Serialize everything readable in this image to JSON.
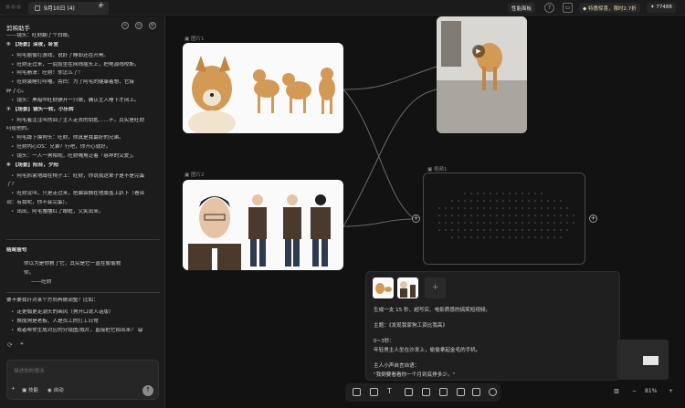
{
  "window": {
    "tab_title": "9月10日 (4)",
    "tab_close": "✕",
    "tab_add": "+"
  },
  "topbar": {
    "perf_label": "性能面板",
    "promo_label": "特惠惊喜，限时2.7折",
    "credits": "77488"
  },
  "sidebar": {
    "title": "剪映助手",
    "lines": [
      {
        "text": "——镜头：旺财翻了个白眼。",
        "style": "normal"
      },
      {
        "text": "⑤ 【场景】深夜，卧室",
        "style": "h"
      },
      {
        "text": "阿毛偷偷打游戏，说好了睡却还在开黑。",
        "style": "bullet"
      },
      {
        "text": "旺财走过来，一屁股坐在网线插头上，把电源线咬断。",
        "style": "bullet"
      },
      {
        "text": "阿毛崩溃：旺财！你怎么了！",
        "style": "bullet"
      },
      {
        "text": "旺财装睡打呼噜。旁白：为了阿毛的健康着想，它接",
        "style": "bullet"
      },
      {
        "text": "  碎了心。",
        "style": "normal"
      },
      {
        "text": "镜头：黑暗中旺财静开一只眼，确认主人睡下才闭上。",
        "style": "bullet"
      },
      {
        "text": "⑦ 【场景】镜头一转，小乐转",
        "style": "h"
      },
      {
        "text": "阿毛着注注叫然回了主人走去的钥匙……不，其实是旺财",
        "style": "bullet"
      },
      {
        "text": "  叼给他的。",
        "style": "normal"
      },
      {
        "text": "阿毛蹲下摸狗头：旺财，你真是我最好的兄弟。",
        "style": "bullet"
      },
      {
        "text": "旺财内心OS：兄弟？行吧，你开心就好。",
        "style": "bullet"
      },
      {
        "text": "镜头：一人一狗相视，旺财嘴角泛着「慈祥的父爱」。",
        "style": "bullet"
      },
      {
        "text": "⑧ 【场景】阳台，夕阳",
        "style": "h"
      },
      {
        "text": "阿毛抓紧地蹲在椅子上：旺财，你说我这辈子是不是完蛋",
        "style": "bullet"
      },
      {
        "text": "  了？",
        "style": "normal"
      },
      {
        "text": "旺财没叫，只是走过来，把脑袋搁在他膝盖上趴下（看台",
        "style": "bullet"
      },
      {
        "text": "  词：有我呢，你不会完蛋）。",
        "style": "normal"
      },
      {
        "text": "出出，阿毛撸撸红了眼眶，又笑出来。",
        "style": "bullet"
      }
    ],
    "ending_title": "结尾金句",
    "ending_quote_1": "你以为是你救了它，其实是它一直在偷偷救",
    "ending_quote_2": "你。",
    "ending_quote_3": "——旺财",
    "followup": "要不要我针对某个方向再做调整？比如：",
    "options": [
      "走更煽更走潮头的画风（狗开口说人话版）",
      "换成狗是老板、人是员工的打工日常",
      "或者帮你生成对应的分镜图/成片，直接把它拍出来？ 😄"
    ],
    "input_placeholder": "描述你的想法",
    "skill_label": "技能",
    "auto_label": "自动",
    "send": "↑"
  },
  "canvas": {
    "card1_label": "图片1",
    "card2_label": "图片2",
    "video_label": "视频1",
    "prompt_lines": [
      "生成一支 15 秒、超写实、电影质感的搞笑短视频。",
      "主题：《发现我家狗工资比我高》",
      "0~3秒：",
      "年轻男主人坐在沙发上，偷偷拿起金毛的手机。",
      "主人小声自言自语：",
      "\"我倒要看看你一个月到底挣多少。\""
    ],
    "zoom": "81%",
    "plus": "+"
  },
  "colors": {
    "bg": "#141414",
    "panel": "#1c1c1c",
    "accent_dog": "#d29a55",
    "suit": "#4a3a2c"
  }
}
